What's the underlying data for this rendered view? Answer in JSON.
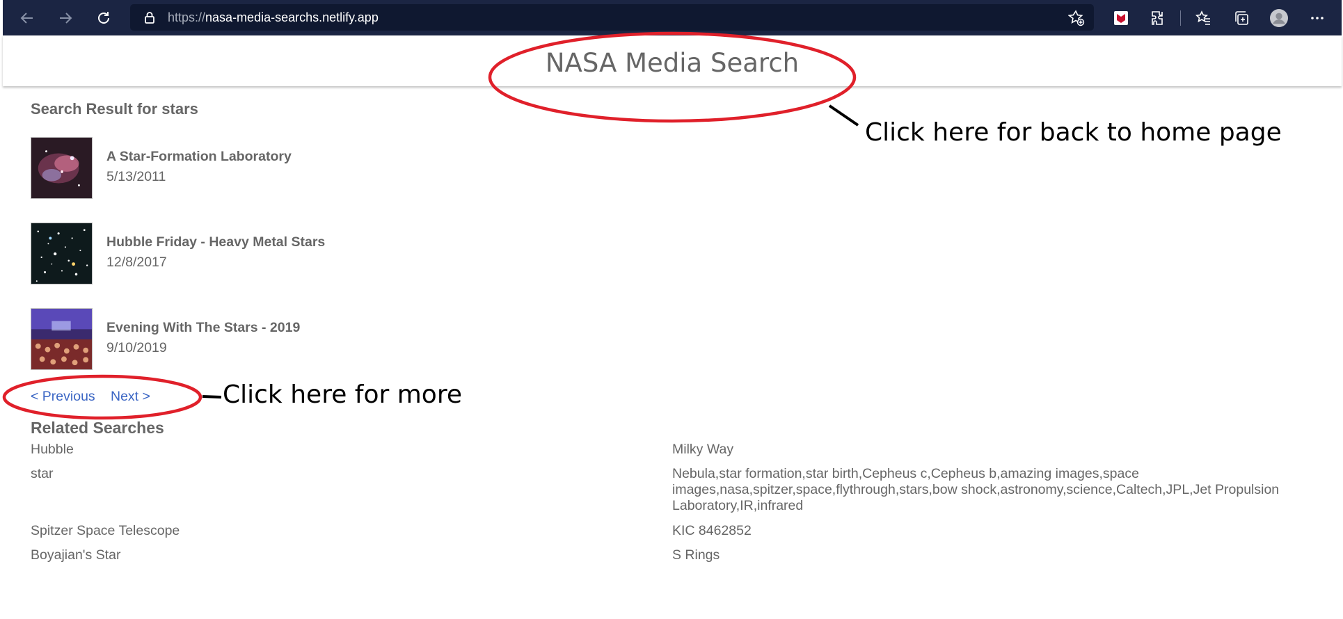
{
  "browser": {
    "url_protocol": "https://",
    "url_host": "nasa-media-searchs.netlify.app",
    "icons": [
      "back-icon",
      "forward-icon",
      "refresh-icon",
      "lock-icon",
      "add-favorite-icon",
      "mcafee-icon",
      "extensions-icon",
      "favorites-icon",
      "collections-icon",
      "profile-icon",
      "more-icon"
    ]
  },
  "header": {
    "title": "NASA Media Search"
  },
  "results": {
    "heading": "Search Result for stars",
    "items": [
      {
        "title": "A Star-Formation Laboratory",
        "date": "5/13/2011"
      },
      {
        "title": "Hubble Friday - Heavy Metal Stars",
        "date": "12/8/2017"
      },
      {
        "title": "Evening With The Stars - 2019",
        "date": "9/10/2019"
      }
    ]
  },
  "pagination": {
    "previous": "< Previous",
    "next": "Next >"
  },
  "related": {
    "heading": "Related Searches",
    "left": [
      "Hubble",
      "star",
      "Spitzer Space Telescope",
      "Boyajian's Star"
    ],
    "right": [
      "Milky Way",
      "Nebula,star formation,star birth,Cepheus c,Cepheus b,amazing images,space images,nasa,spitzer,space,flythrough,stars,bow shock,astronomy,science,Caltech,JPL,Jet Propulsion Laboratory,IR,infrared",
      "KIC 8462852",
      "S Rings"
    ]
  },
  "annotations": {
    "home_note": "Click here for back to home page",
    "more_note": "Click here for more",
    "circle_color": "#e0202a"
  }
}
